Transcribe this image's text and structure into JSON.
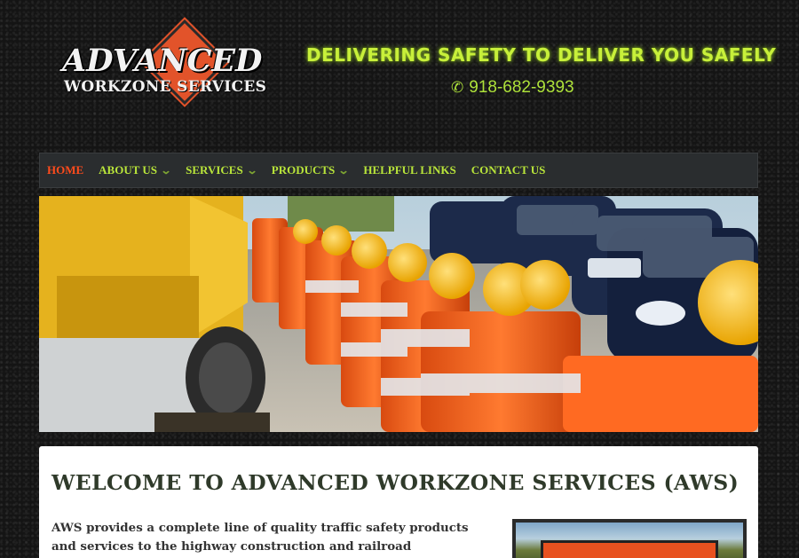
{
  "header": {
    "logo_line1": "ADVANCED",
    "logo_line2": "WORKZONE SERVICES",
    "tagline": "DELIVERING SAFETY TO DELIVER YOU SAFELY",
    "phone": "918-682-9393",
    "phone_icon": "phone-icon"
  },
  "nav": {
    "items": [
      {
        "label": "HOME",
        "active": true,
        "dropdown": false
      },
      {
        "label": "ABOUT US",
        "active": false,
        "dropdown": true
      },
      {
        "label": "SERVICES",
        "active": false,
        "dropdown": true
      },
      {
        "label": "PRODUCTS",
        "active": false,
        "dropdown": true
      },
      {
        "label": "HELPFUL LINKS",
        "active": false,
        "dropdown": false
      },
      {
        "label": "CONTACT US",
        "active": false,
        "dropdown": false
      }
    ],
    "chevron": "⌄"
  },
  "main": {
    "heading": "WELCOME TO ADVANCED WORKZONE SERVICES (AWS)",
    "intro": "AWS provides a complete line of quality traffic safety products and services to the highway construction and railroad industries."
  },
  "colors": {
    "accent_green": "#b9e53a",
    "active_orange": "#ff4b1c",
    "logo_orange": "#e2532a",
    "nav_bg": "#2a2d2f"
  }
}
